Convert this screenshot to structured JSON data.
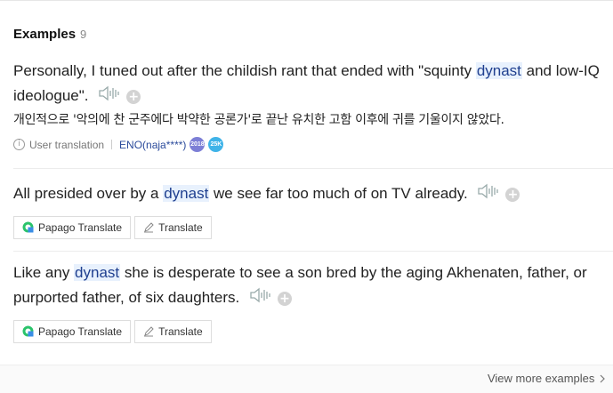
{
  "section": {
    "title": "Examples",
    "count": "9"
  },
  "examples": [
    {
      "parts": [
        "Personally, I tuned out after the childish rant that ended with \"squinty ",
        "dynast",
        " and low-IQ ideologue\"."
      ],
      "translation": "개인적으로 '악의에 찬 군주에다 박약한 공론가'로 끝난 유치한 고함 이후에 귀를 기울이지 않았다.",
      "meta": {
        "source_label": "User translation",
        "user": "ENO(naja****)",
        "badges": [
          "2018",
          "25K"
        ]
      }
    },
    {
      "parts": [
        "All presided over by a ",
        "dynast",
        " we see far too much of on TV already."
      ],
      "buttons": {
        "papago": "Papago Translate",
        "translate": "Translate"
      }
    },
    {
      "parts": [
        "Like any ",
        "dynast",
        " she is desperate to see a son bred by the aging Akhenaten, father, or purported father, of six daughters."
      ],
      "buttons": {
        "papago": "Papago Translate",
        "translate": "Translate"
      }
    }
  ],
  "footer": {
    "more_label": "View more examples"
  },
  "icons": {
    "audio": "speaker-icon",
    "add": "plus-icon",
    "info": "info-icon",
    "papago": "papago-icon",
    "pencil": "pencil-icon",
    "chevron": "chevron-right-icon"
  }
}
